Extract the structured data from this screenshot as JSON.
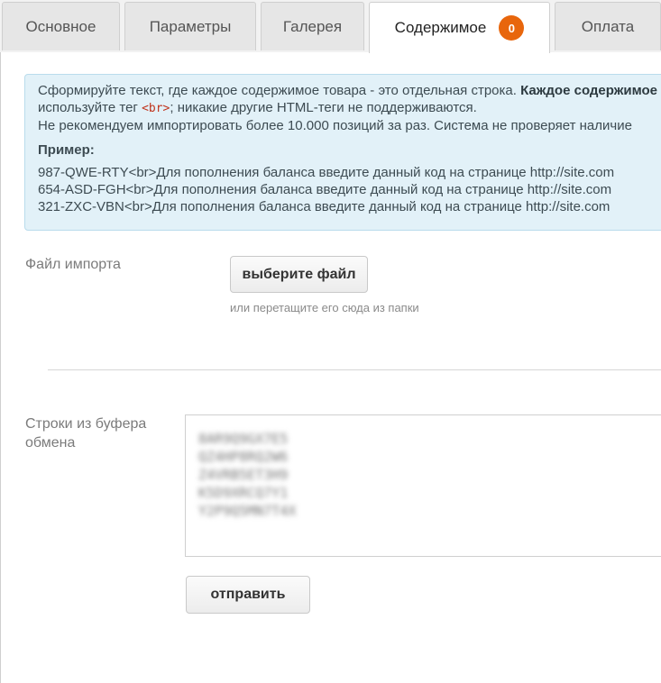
{
  "tabs": [
    {
      "label": "Основное"
    },
    {
      "label": "Параметры"
    },
    {
      "label": "Галерея"
    },
    {
      "label": "Содержимое",
      "badge": "0"
    },
    {
      "label": "Оплата"
    }
  ],
  "info": {
    "line1_normal": "Сформируйте текст, где каждое содержимое товара - это отдельная строка. ",
    "line1_bold": "Каждое содержимое",
    "line2_before": "используйте тег ",
    "line2_tag": "<br>",
    "line2_after": "; никакие другие HTML-теги не поддерживаются.",
    "line3": "Не рекомендуем импортировать более 10.000 позиций за раз. Система не проверяет наличие",
    "example_title": "Пример:",
    "examples": [
      "987-QWE-RTY<br>Для пополнения баланса введите данный код на странице http://site.com",
      "654-ASD-FGH<br>Для пополнения баланса введите данный код на странице http://site.com",
      "321-ZXC-VBN<br>Для пополнения баланса введите данный код на странице http://site.com"
    ]
  },
  "import": {
    "label": "Файл импорта",
    "button": "выберите файл",
    "hint": "или перетащите его сюда из папки"
  },
  "clipboard": {
    "label": "Строки из буфера обмена",
    "lines": [
      "8AR9Q9GX7E5",
      "QZ4HP8RQ2W6",
      "Z4VRB5ET3H9",
      "K5D9XRCQ7Y1",
      "Y2P9Q5MN7T4X"
    ],
    "submit": "отправить"
  },
  "colors": {
    "badge": "#e8660c",
    "info_bg": "#e2f1f8",
    "tag": "#c0341d"
  }
}
